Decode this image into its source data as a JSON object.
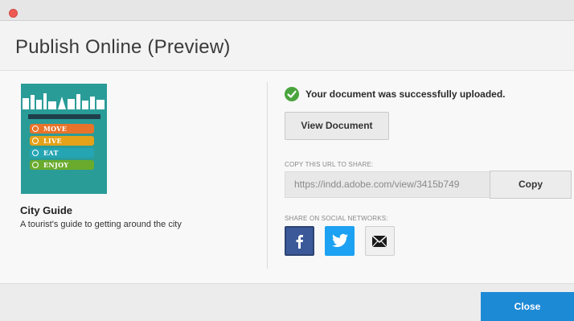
{
  "dialog": {
    "title": "Publish Online (Preview)"
  },
  "document": {
    "title": "City Guide",
    "description": "A tourist's guide to getting around the city",
    "cover": {
      "items": [
        {
          "label": "MOVE",
          "color": "#e8732a"
        },
        {
          "label": "LIVE",
          "color": "#e3a21a"
        },
        {
          "label": "EAT",
          "color": "#25a5b3"
        },
        {
          "label": "ENJOY",
          "color": "#6aab2d"
        }
      ],
      "background": "#2a9c98"
    }
  },
  "status": {
    "message": "Your document was successfully uploaded.",
    "icon": "check-circle-icon",
    "color": "#4aa43d"
  },
  "actions": {
    "view_document": "View Document",
    "copy": "Copy",
    "close": "Close"
  },
  "share": {
    "url_label": "COPY THIS URL TO SHARE:",
    "url": "https://indd.adobe.com/view/3415b749",
    "social_label": "SHARE ON SOCIAL NETWORKS:",
    "networks": [
      {
        "name": "facebook",
        "icon": "facebook-icon",
        "color": "#3b5998"
      },
      {
        "name": "twitter",
        "icon": "twitter-icon",
        "color": "#1da1f2"
      },
      {
        "name": "email",
        "icon": "email-icon",
        "color": "#f0f0f0"
      }
    ]
  },
  "colors": {
    "primary": "#1d8ad6"
  }
}
